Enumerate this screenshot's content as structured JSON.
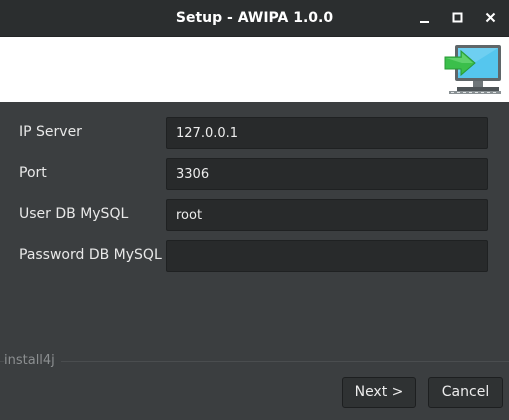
{
  "window": {
    "title": "Setup - AWIPA 1.0.0",
    "controls": [
      "minimize-icon",
      "maximize-icon",
      "close-icon"
    ]
  },
  "banner": {
    "icon": "installer-monitor-arrow-icon",
    "colors": {
      "arrow": "#3bbf4b",
      "screen": "#55c6ee",
      "monitor": "#5f6669"
    }
  },
  "form": {
    "fields": [
      {
        "label": "IP Server",
        "value": "127.0.0.1"
      },
      {
        "label": "Port",
        "value": "3306"
      },
      {
        "label": "User DB MySQL",
        "value": "root"
      },
      {
        "label": "Password DB MySQL",
        "value": ""
      }
    ]
  },
  "footer": {
    "brand": "install4j",
    "next_label": "Next >",
    "cancel_label": "Cancel"
  }
}
